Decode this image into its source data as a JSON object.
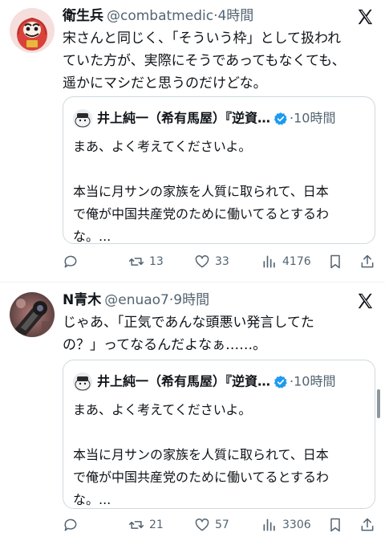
{
  "posts": [
    {
      "author_name": "衛生兵",
      "handle": "@combatmedic",
      "separator": "·",
      "time": "4時間",
      "text_lines": [
        "宋さんと同じく、「そういう枠」として扱われ",
        "ていた方が、実際にそうであってもなくても、",
        "遥かにマシだと思うのだけどな。"
      ],
      "quote": {
        "author_name": "井上純一（希有馬屋）『逆資…",
        "separator": "·",
        "time": "10時間",
        "line1": "まあ、よく考えてくださいよ。",
        "line2": "本当に月サンの家族を人質に取られて、日本",
        "line3": "で俺が中国共産党のために働いてるとするわ",
        "line4": "な。..."
      },
      "stats": {
        "replies": "",
        "reposts": "13",
        "likes": "33",
        "views": "4176"
      }
    },
    {
      "author_name": "N青木",
      "handle": "@enuao7",
      "separator": "·",
      "time": "9時間",
      "text_lines": [
        "じゃあ、「正気であんな頭悪い発言してた",
        "の？」ってなるんだよなぁ……。"
      ],
      "quote": {
        "author_name": "井上純一（希有馬屋）『逆資…",
        "separator": "·",
        "time": "10時間",
        "line1": "まあ、よく考えてくださいよ。",
        "line2": "本当に月サンの家族を人質に取られて、日本",
        "line3": "で俺が中国共産党のために働いてるとするわ",
        "line4": "な。..."
      },
      "stats": {
        "replies": "",
        "reposts": "21",
        "likes": "57",
        "views": "3306"
      }
    }
  ],
  "icons": {
    "reply": "reply-icon",
    "repost": "repost-icon",
    "like": "heart-icon",
    "views": "views-icon",
    "bookmark": "bookmark-icon",
    "share": "share-icon",
    "platform": "x-logo-icon",
    "verified": "verified-badge-icon"
  },
  "colors": {
    "text": "#0f1419",
    "muted": "#536471",
    "border": "#cfd9de",
    "verified": "#1d9bf0"
  }
}
